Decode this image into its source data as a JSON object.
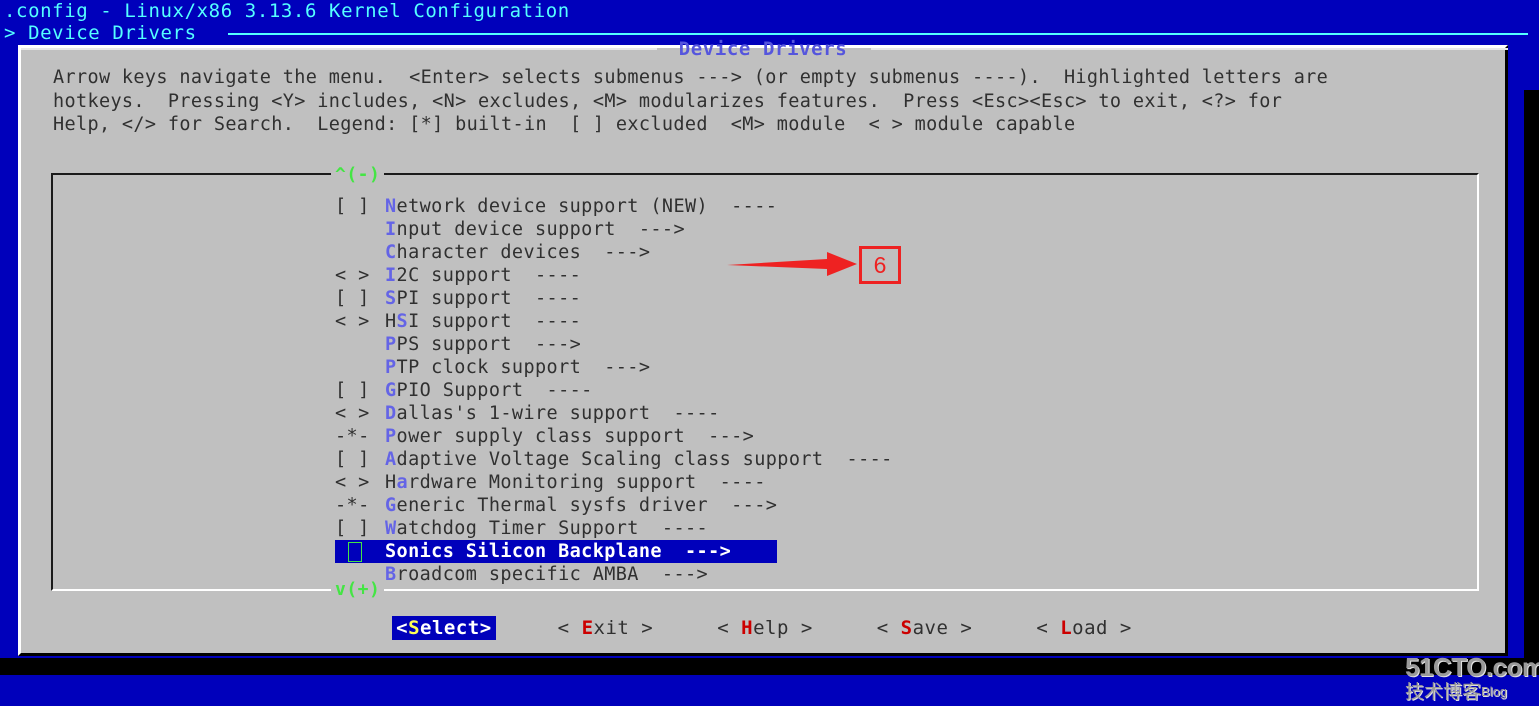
{
  "terminal": {
    "title": ".config - Linux/x86 3.13.6 Kernel Configuration",
    "breadcrumb": "> Device Drivers"
  },
  "dialog": {
    "title": "Device Drivers",
    "help_lines": "Arrow keys navigate the menu.  <Enter> selects submenus ---> (or empty submenus ----).  Highlighted letters are\nhotkeys.  Pressing <Y> includes, <N> excludes, <M> modularizes features.  Press <Esc><Esc> to exit, <?> for\nHelp, </> for Search.  Legend: [*] built-in  [ ] excluded  <M> module  < > module capable"
  },
  "menu": {
    "scroll_up": "^(-)",
    "scroll_down": "v(+)",
    "items": [
      {
        "mark": "[ ]",
        "hot": "N",
        "pre": "",
        "post": "etwork device support (NEW)  ----",
        "selected": false
      },
      {
        "mark": "",
        "hot": "I",
        "pre": "",
        "post": "nput device support  --->",
        "selected": false
      },
      {
        "mark": "",
        "hot": "C",
        "pre": "",
        "post": "haracter devices  --->",
        "selected": false
      },
      {
        "mark": "< >",
        "hot": "I",
        "pre": "",
        "post": "2C support  ----",
        "selected": false
      },
      {
        "mark": "[ ]",
        "hot": "S",
        "pre": "",
        "post": "PI support  ----",
        "selected": false
      },
      {
        "mark": "< >",
        "hot": "S",
        "pre": "H",
        "post": "I support  ----",
        "selected": false
      },
      {
        "mark": "",
        "hot": "P",
        "pre": "",
        "post": "PS support  --->",
        "selected": false
      },
      {
        "mark": "",
        "hot": "P",
        "pre": "",
        "post": "TP clock support  --->",
        "selected": false
      },
      {
        "mark": "[ ]",
        "hot": "G",
        "pre": "",
        "post": "PIO Support  ----",
        "selected": false
      },
      {
        "mark": "< >",
        "hot": "D",
        "pre": "",
        "post": "allas's 1-wire support  ----",
        "selected": false
      },
      {
        "mark": "-*-",
        "hot": "P",
        "pre": "",
        "post": "ower supply class support  --->",
        "selected": false
      },
      {
        "mark": "[ ]",
        "hot": "A",
        "pre": "",
        "post": "daptive Voltage Scaling class support  ----",
        "selected": false
      },
      {
        "mark": "< >",
        "hot": "a",
        "pre": "H",
        "post": "rdware Monitoring support  ----",
        "selected": false
      },
      {
        "mark": "-*-",
        "hot": "G",
        "pre": "",
        "post": "eneric Thermal sysfs driver  --->",
        "selected": false
      },
      {
        "mark": "[ ]",
        "hot": "W",
        "pre": "",
        "post": "atchdog Timer Support  ----",
        "selected": false
      },
      {
        "mark": "",
        "hot": "S",
        "pre": "",
        "post": "onics Silicon Backplane  --->",
        "selected": true
      },
      {
        "mark": "",
        "hot": "B",
        "pre": "",
        "post": "roadcom specific AMBA  --->",
        "selected": false
      }
    ]
  },
  "buttons": [
    {
      "pre": "<",
      "hot": "S",
      "post": "elect>",
      "active": true
    },
    {
      "pre": "< ",
      "hot": "E",
      "post": "xit >",
      "active": false
    },
    {
      "pre": "< ",
      "hot": "H",
      "post": "elp >",
      "active": false
    },
    {
      "pre": "< ",
      "hot": "S",
      "post": "ave >",
      "active": false
    },
    {
      "pre": "< ",
      "hot": "L",
      "post": "oad >",
      "active": false
    }
  ],
  "annotation": {
    "step_number": "6",
    "color": "#ee2222"
  },
  "watermark": {
    "top": "51CTO.com",
    "bottom_cn": "技术博客",
    "bottom_en": "Blog"
  },
  "colors": {
    "terminal_blue": "#0000bb",
    "dialog_gray": "#c0c0c0",
    "cyan_title": "#55ffff",
    "hotkey_blue": "#6464e6",
    "hotkey_red": "#cc0000",
    "scroll_green": "#44e544",
    "selection_blue": "#0000bb"
  }
}
